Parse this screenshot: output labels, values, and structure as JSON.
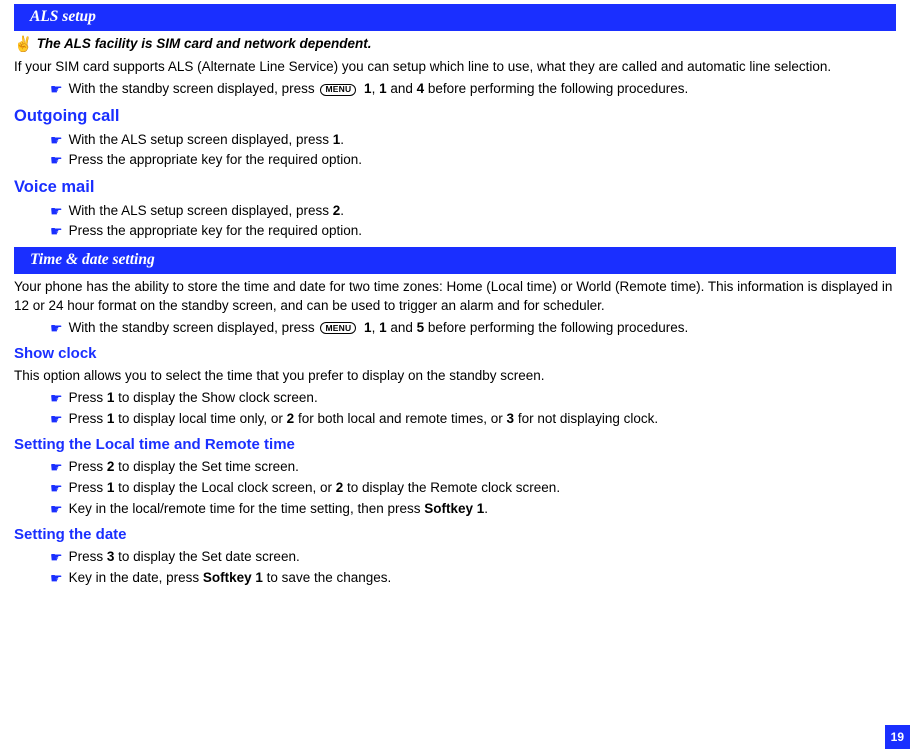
{
  "sections": {
    "als": {
      "title": "ALS setup",
      "note": "The ALS facility is SIM card and network dependent.",
      "intro": "If your SIM card supports ALS (Alternate Line Service) you can setup which line to use, what they are called and automatic line selection.",
      "menuSteps": {
        "prefix": "With the standby screen displayed, press ",
        "menuLabel": "MENU",
        "k1": "1",
        "k2": "1",
        "k3": "4",
        "suffix": " before performing the following procedures."
      },
      "outgoing": {
        "heading": "Outgoing call",
        "b1_pre": "With the ALS setup screen displayed, press ",
        "b1_key": "1",
        "b1_post": ".",
        "b2": "Press the appropriate key for the required option."
      },
      "voicemail": {
        "heading": "Voice mail",
        "b1_pre": "With the ALS setup screen displayed, press ",
        "b1_key": "2",
        "b1_post": ".",
        "b2": "Press the appropriate key for the required option."
      }
    },
    "time": {
      "title": "Time & date setting",
      "intro": "Your phone has the ability to store the time and date for two time zones: Home (Local time) or World (Remote time). This information is displayed in 12 or 24 hour format on the standby screen, and can be used to trigger an alarm and for scheduler.",
      "menuSteps": {
        "prefix": "With the standby screen displayed, press ",
        "menuLabel": "MENU",
        "k1": "1",
        "k2": "1",
        "k3": "5",
        "suffix": " before performing the following procedures."
      },
      "showClock": {
        "heading": "Show clock",
        "intro": "This option allows you to select the time that you prefer to display on the standby screen.",
        "b1_pre": "Press ",
        "b1_k": "1",
        "b1_post": " to display the Show clock screen.",
        "b2_pre": "Press ",
        "b2_k1": "1",
        "b2_mid1": " to display local time only, or ",
        "b2_k2": "2",
        "b2_mid2": " for both local and remote times, or ",
        "b2_k3": "3",
        "b2_post": " for not displaying clock."
      },
      "setTime": {
        "heading": "Setting the Local time and Remote time",
        "b1_pre": "Press ",
        "b1_k": "2",
        "b1_post": " to display the Set time screen.",
        "b2_pre": "Press ",
        "b2_k1": "1",
        "b2_mid": " to display the Local clock screen, or ",
        "b2_k2": "2",
        "b2_post": " to display the Remote clock screen.",
        "b3_pre": "Key in the local/remote time for the time setting, then press ",
        "b3_k": "Softkey 1",
        "b3_post": "."
      },
      "setDate": {
        "heading": "Setting the date",
        "b1_pre": "Press ",
        "b1_k": "3",
        "b1_post": " to display the Set date screen.",
        "b2_pre": "Key in the date, press ",
        "b2_k": "Softkey 1",
        "b2_post": " to save the changes."
      }
    }
  },
  "pageNumber": "19"
}
